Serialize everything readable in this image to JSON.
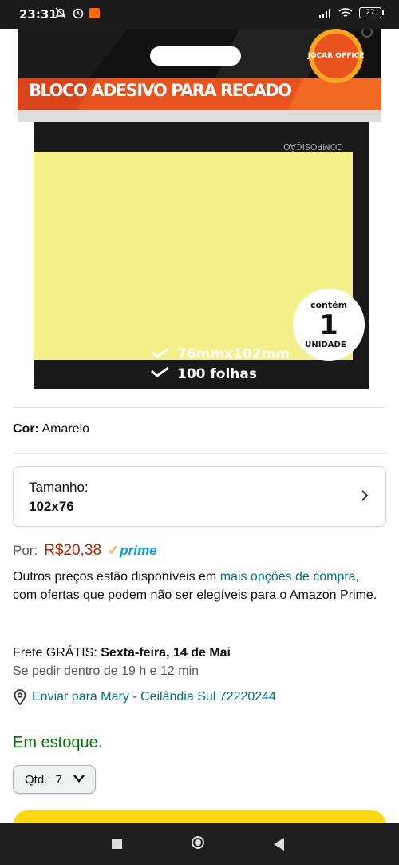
{
  "status_bar": {
    "time": "23:31",
    "battery": "27"
  },
  "product_image": {
    "title": "BLOCO ADESIVO PARA RECADO",
    "brand": "JOCAR OFFICE",
    "badge_top": "contém",
    "badge_num": "1",
    "badge_bottom": "UNIDADE",
    "spec1": "76mmx102mm",
    "spec2": "100 folhas",
    "composicao": "COMPOSIÇÃO"
  },
  "color": {
    "label": "Cor:",
    "value": "Amarelo"
  },
  "size": {
    "label": "Tamanho:",
    "value": "102x76"
  },
  "price": {
    "label": "Por:",
    "value": "R$20,38",
    "prime": "prime"
  },
  "offers": {
    "prefix": "Outros preços estão disponíveis em ",
    "link": "mais opções de compra",
    "suffix": ", com ofertas que podem não ser elegíveis para o Amazon Prime."
  },
  "delivery": {
    "prefix": "Frete GRÁTIS: ",
    "date": "Sexta-feira, 14 de Mai",
    "deadline": "Se pedir dentro de 19 h e 12 min"
  },
  "ship_to": "Enviar para Mary - Ceilândia Sul 72220244",
  "stock": "Em estoque.",
  "quantity": {
    "label": "Qtd.:",
    "value": "7"
  },
  "colors": {
    "link": "#007185",
    "price": "#b12704",
    "stock": "#007600",
    "buy": "#ffd814",
    "note": "#f3f08a"
  }
}
